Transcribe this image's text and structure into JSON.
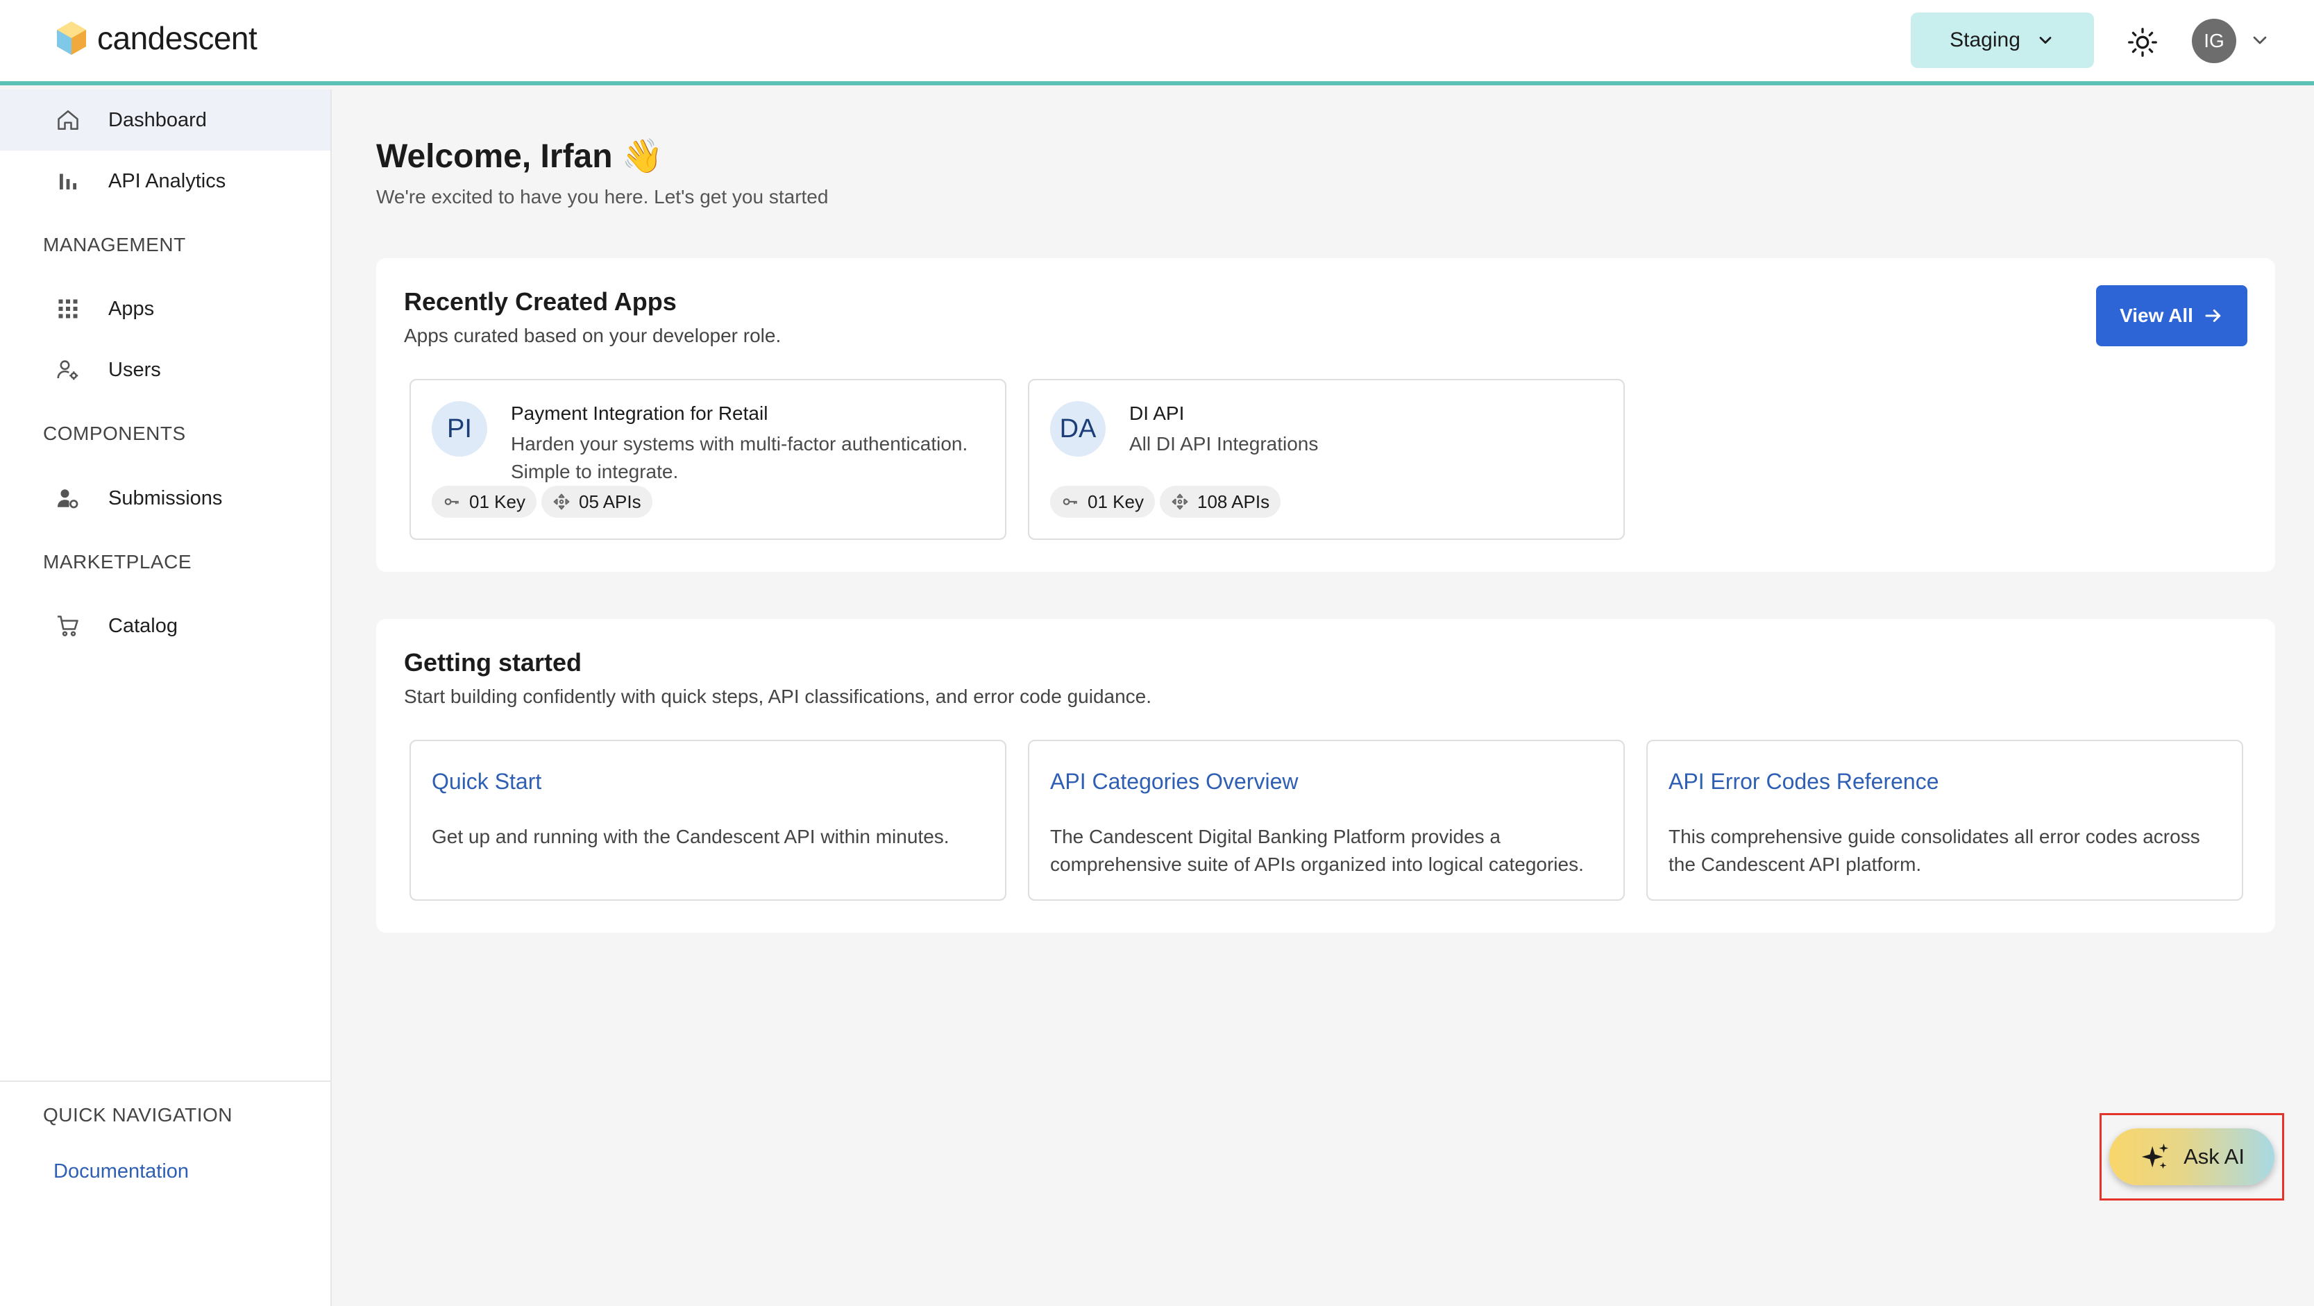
{
  "header": {
    "brand": "candescent",
    "environment": "Staging",
    "user_initials": "IG"
  },
  "sidebar": {
    "items": [
      {
        "label": "Dashboard"
      },
      {
        "label": "API Analytics"
      }
    ],
    "sections": {
      "management": "MANAGEMENT",
      "components": "COMPONENTS",
      "marketplace": "MARKETPLACE",
      "quick_navigation": "QUICK NAVIGATION"
    },
    "management_items": [
      {
        "label": "Apps"
      },
      {
        "label": "Users"
      }
    ],
    "components_items": [
      {
        "label": "Submissions"
      }
    ],
    "marketplace_items": [
      {
        "label": "Catalog"
      }
    ],
    "quick_links": [
      {
        "label": "Documentation"
      }
    ]
  },
  "welcome": {
    "greeting": "Welcome,",
    "name": "Irfan",
    "emoji": "👋",
    "subtitle": "We're excited to have you here. Let's get you started"
  },
  "recent_apps": {
    "title": "Recently Created Apps",
    "subtitle": "Apps curated based on your developer role.",
    "view_all_label": "View All",
    "apps": [
      {
        "initials": "PI",
        "name": "Payment Integration for Retail",
        "description": "Harden your systems with multi-factor authentication. Simple to integrate.",
        "keys": "01 Key",
        "apis": "05 APIs"
      },
      {
        "initials": "DA",
        "name": "DI API",
        "description": "All DI API Integrations",
        "keys": "01 Key",
        "apis": "108 APIs"
      }
    ]
  },
  "getting_started": {
    "title": "Getting started",
    "subtitle": "Start building confidently with quick steps, API classifications, and error code guidance.",
    "guides": [
      {
        "title": "Quick Start",
        "description": "Get up and running with the Candescent API within minutes."
      },
      {
        "title": "API Categories Overview",
        "description": "The Candescent Digital Banking Platform provides a comprehensive suite of APIs organized into logical categories."
      },
      {
        "title": "API Error Codes Reference",
        "description": "This comprehensive guide consolidates all error codes across the Candescent API platform."
      }
    ]
  },
  "ask_ai": {
    "label": "Ask AI"
  },
  "colors": {
    "accent": "#5cc0b5",
    "primary_button": "#2d64d6",
    "link": "#2e5fb4",
    "environment_bg": "#c9eeee",
    "highlight_frame": "#e5342c"
  }
}
